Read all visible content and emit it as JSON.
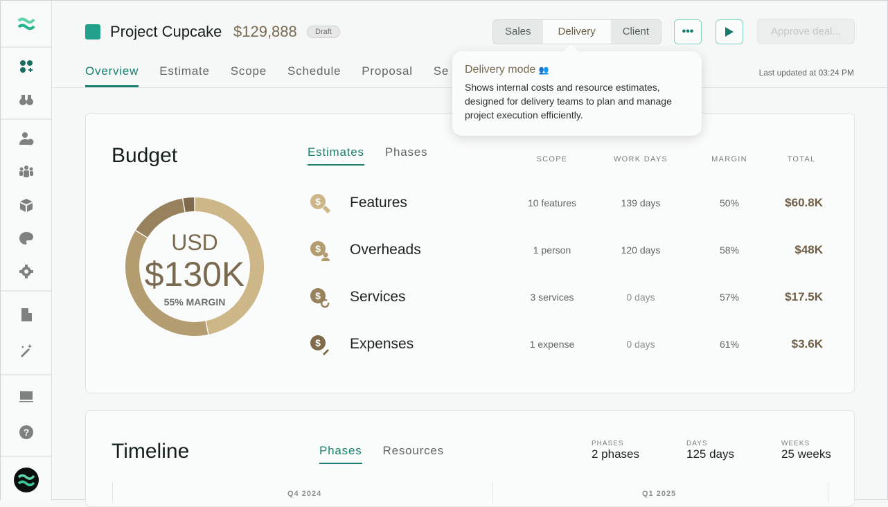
{
  "header": {
    "title": "Project Cupcake",
    "price": "$129,888",
    "status": "Draft",
    "modes": [
      "Sales",
      "Delivery",
      "Client"
    ],
    "active_mode": "Delivery",
    "more_icon": "ellipsis-icon",
    "play_icon": "play-icon",
    "approve_label": "Approve deal...",
    "last_updated": "Last updated at 03:24 PM"
  },
  "tabs": [
    "Overview",
    "Estimate",
    "Scope",
    "Schedule",
    "Proposal",
    "Se"
  ],
  "tooltip": {
    "title": "Delivery mode",
    "body": "Shows internal costs and resource estimates, designed for delivery teams to plan and manage project execution efficiently."
  },
  "sidebar": {
    "icons": [
      "apps-icon",
      "binoculars-icon",
      "user-dollar-icon",
      "team-icon",
      "box-icon",
      "palette-icon",
      "gear-icon",
      "building-icon",
      "magic-wand-icon",
      "laptop-icon",
      "help-icon"
    ]
  },
  "colors": {
    "accent": "#1a7f6e",
    "brown": "#7a6a50",
    "segments": [
      "#cdb688",
      "#b39c70",
      "#97825d",
      "#7f6b4b"
    ]
  },
  "budget": {
    "title": "Budget",
    "tabs": [
      "Estimates",
      "Phases"
    ],
    "currency": "USD",
    "total": "$130K",
    "margin": "55% MARGIN",
    "columns": [
      "SCOPE",
      "WORK DAYS",
      "MARGIN",
      "TOTAL"
    ],
    "rows": [
      {
        "name": "Features",
        "scope": "10 features",
        "days": "139 days",
        "margin": "50%",
        "total": "$60.8K",
        "value": 60.8
      },
      {
        "name": "Overheads",
        "scope": "1 person",
        "days": "120 days",
        "margin": "58%",
        "total": "$48K",
        "value": 48
      },
      {
        "name": "Services",
        "scope": "3 services",
        "days": "0 days",
        "margin": "57%",
        "total": "$17.5K",
        "value": 17.5
      },
      {
        "name": "Expenses",
        "scope": "1 expense",
        "days": "0 days",
        "margin": "61%",
        "total": "$3.6K",
        "value": 3.6
      }
    ]
  },
  "timeline": {
    "title": "Timeline",
    "tabs": [
      "Phases",
      "Resources"
    ],
    "stats": [
      {
        "label": "PHASES",
        "value": "2 phases"
      },
      {
        "label": "DAYS",
        "value": "125 days"
      },
      {
        "label": "WEEKS",
        "value": "25 weeks"
      }
    ],
    "quarters": [
      "Q4 2024",
      "Q1 2025"
    ]
  }
}
